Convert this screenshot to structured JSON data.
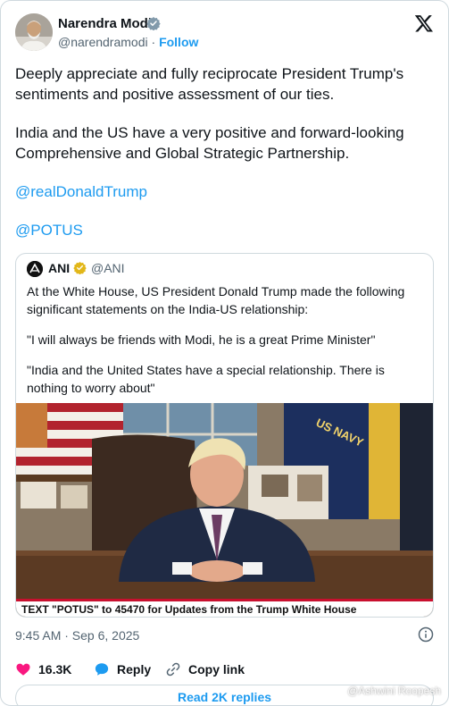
{
  "author": {
    "name": "Narendra Modi",
    "handle": "@narendramodi",
    "separator": "·",
    "follow_label": "Follow"
  },
  "tweet": {
    "para1": "Deeply appreciate and fully reciprocate President Trump's sentiments and positive assessment of our ties.",
    "para2": "India and the US have a very positive and forward-looking Comprehensive and Global Strategic Partnership.",
    "mention1": "@realDonaldTrump",
    "mention2": "@POTUS"
  },
  "quote": {
    "name": "ANI",
    "handle": "@ANI",
    "para1": "At the White House, US President Donald Trump made the following significant statements on the India-US relationship:",
    "para2": "\"I will always be friends with Modi, he is a great Prime Minister\"",
    "para3": "\"India and the United States have a special relationship. There is nothing to worry about\"",
    "chyron": "TEXT \"POTUS\" to 45470 for Updates from the Trump White House",
    "flag_text": "US NAVY"
  },
  "meta": {
    "timestamp": "9:45 AM · Sep 6, 2025"
  },
  "actions": {
    "likes": "16.3K",
    "reply_label": "Reply",
    "copy_label": "Copy link"
  },
  "replies_button": "Read 2K replies",
  "watermark": "@Ashwini Roopesh",
  "colors": {
    "accent": "#1d9bf0",
    "like": "#f91880",
    "verified_gold": "#e2b719"
  }
}
